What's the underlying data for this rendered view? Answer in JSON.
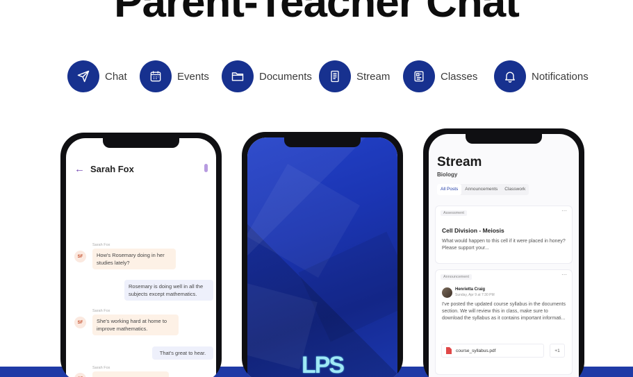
{
  "headline": "Parent-Teacher Chat",
  "features": [
    {
      "label": "Chat",
      "icon": "send-icon"
    },
    {
      "label": "Events",
      "icon": "calendar-icon"
    },
    {
      "label": "Documents",
      "icon": "folder-icon"
    },
    {
      "label": "Stream",
      "icon": "stream-icon"
    },
    {
      "label": "Classes",
      "icon": "classes-icon"
    },
    {
      "label": "Notifications",
      "icon": "bell-icon"
    }
  ],
  "colors": {
    "brand": "#17318f",
    "band": "#1f3aa6",
    "splash": "#1b35b3",
    "logo": "#9fe8f5"
  },
  "chat": {
    "contact_name": "Sarah Fox",
    "avatar_initials": "SF",
    "messages": [
      {
        "from": "Sarah Fox",
        "direction": "in",
        "text": "How's Rosemary doing in her studies lately?"
      },
      {
        "direction": "out",
        "text": "Rosemary is doing well in all the subjects except mathematics."
      },
      {
        "from": "Sarah Fox",
        "direction": "in",
        "text": "She's working hard at home to improve mathematics."
      },
      {
        "direction": "out",
        "text": "That's great to hear."
      },
      {
        "from": "Sarah Fox",
        "direction": "in",
        "text": ""
      }
    ]
  },
  "splash": {
    "logo": "LPS"
  },
  "stream": {
    "title": "Stream",
    "subject": "Biology",
    "tabs": [
      "All Posts",
      "Announcements",
      "Classwork"
    ],
    "cards": [
      {
        "tag": "Assessment",
        "title": "Cell Division - Meiosis",
        "body": "What would happen to this cell if it were placed in honey? Please support your..."
      },
      {
        "tag": "Announcement",
        "author": "Henrietta Craig",
        "time": "Sunday, Apr 9 at 7:30 PM",
        "body": "I've posted the updated course syllabus in the documents section. We will review this in class, make sure to download the syllabus as it contains important informati...",
        "attachment": "course_syllabus.pdf",
        "extra": "+1"
      }
    ]
  }
}
